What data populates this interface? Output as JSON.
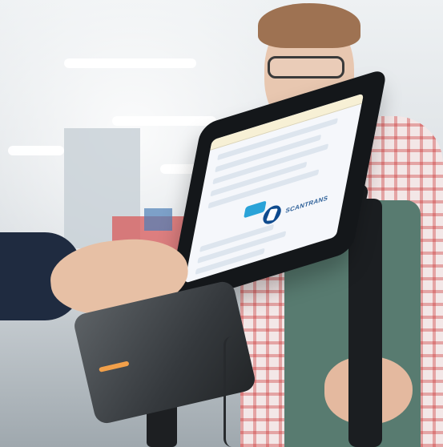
{
  "scene": {
    "tablet_screen": {
      "brand_text": "SCANTRANS"
    }
  }
}
